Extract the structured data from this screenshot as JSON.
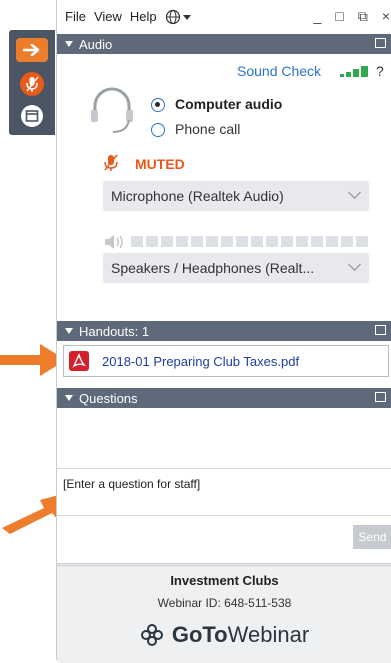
{
  "menu": {
    "file": "File",
    "view": "View",
    "help": "Help"
  },
  "window": {
    "minimize": "_",
    "maximize": "□",
    "restore": "⧉",
    "close": "×"
  },
  "audio": {
    "header": "Audio",
    "sound_check": "Sound Check",
    "help": "?",
    "options": [
      "Computer audio",
      "Phone call"
    ],
    "selected": "Computer audio",
    "muted_label": "MUTED",
    "microphone": "Microphone (Realtek Audio)",
    "speakers": "Speakers / Headphones (Realt..."
  },
  "handouts": {
    "header": "Handouts: 1",
    "items": [
      "2018-01 Preparing Club Taxes.pdf"
    ]
  },
  "questions": {
    "header": "Questions",
    "placeholder": "[Enter a question for staff]",
    "send": "Send"
  },
  "webinar": {
    "title": "Investment Clubs",
    "id_label": "Webinar ID: 648-511-538",
    "brand_bold": "GoTo",
    "brand_light": "Webinar"
  },
  "colors": {
    "header_bg": "#5e6a7a",
    "strip_bg": "#4a5664",
    "accent_orange": "#ee7d2b",
    "muted_orange": "#e8591a",
    "link_blue": "#2b73c7",
    "pdf_red": "#d3202a",
    "signal_green": "#2fa84f"
  },
  "icons": {
    "strip": [
      "arrow-right-icon",
      "mic-muted-icon",
      "window-icon"
    ],
    "audio": "headset-icon",
    "pdf": "pdf-icon",
    "globe": "globe-icon",
    "brand": "gotowebinar-logo-icon"
  }
}
